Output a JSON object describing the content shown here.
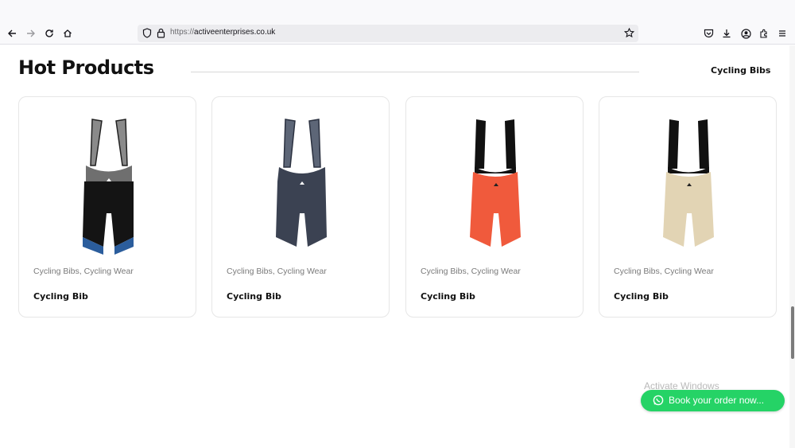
{
  "browser": {
    "url_scheme": "https://",
    "url_host": "activeenterprises.co.uk"
  },
  "section": {
    "title": "Hot Products",
    "tab_label": "Cycling Bibs"
  },
  "products": [
    {
      "categories": "Cycling Bibs, Cycling Wear",
      "name": "Cycling Bib",
      "style": "black-grey-camo"
    },
    {
      "categories": "Cycling Bibs, Cycling Wear",
      "name": "Cycling Bib",
      "style": "navy-grey"
    },
    {
      "categories": "Cycling Bibs, Cycling Wear",
      "name": "Cycling Bib",
      "style": "orange-black"
    },
    {
      "categories": "Cycling Bibs, Cycling Wear",
      "name": "Cycling Bib",
      "style": "beige-black"
    }
  ],
  "colors": {
    "whatsapp_green": "#25d366",
    "bib1_body": "#141414",
    "bib1_strap": "#8a8a8a",
    "bib2_body": "#3b4252",
    "bib2_strap": "#5d6677",
    "bib3_body": "#f05a3c",
    "bib3_strap": "#111111",
    "bib4_body": "#e2d4b4",
    "bib4_strap": "#111111"
  },
  "os_watermark": "Activate Windows",
  "cta": {
    "label": "Book your order now...",
    "icon": "whatsapp-icon"
  }
}
